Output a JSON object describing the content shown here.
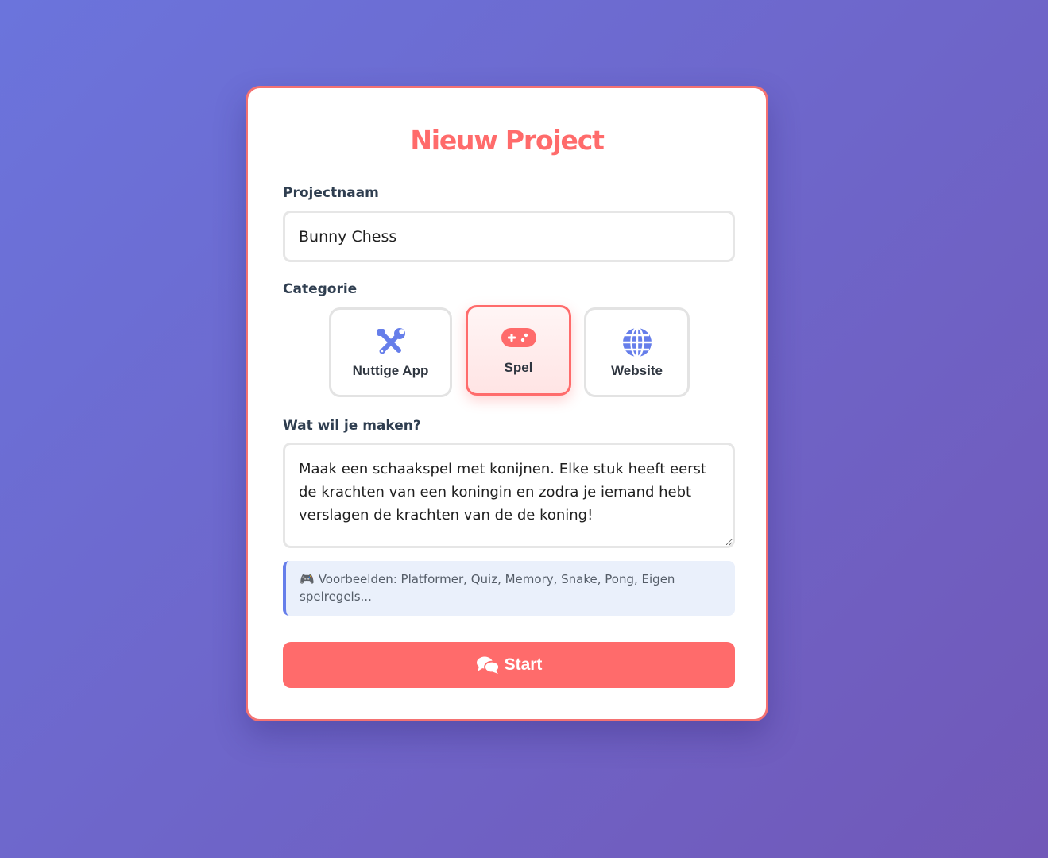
{
  "page": {
    "title": "Nieuw Project"
  },
  "colors": {
    "accent": "#ff6b6b",
    "icon": "#667eea",
    "background_start": "#6b74dc",
    "background_end": "#7158b8"
  },
  "form": {
    "project_name": {
      "label": "Projectnaam",
      "value": "Bunny Chess"
    },
    "category": {
      "label": "Categorie",
      "selected": "Spel",
      "options": [
        {
          "label": "Nuttige App",
          "icon": "tools-icon"
        },
        {
          "label": "Spel",
          "icon": "gamepad-icon"
        },
        {
          "label": "Website",
          "icon": "globe-icon"
        }
      ]
    },
    "description": {
      "label": "Wat wil je maken?",
      "value": "Maak een schaakspel met konijnen. Elke stuk heeft eerst de krachten van een koningin en zodra je iemand hebt verslagen de krachten van de de koning!"
    },
    "hint": {
      "icon": "🎮",
      "text": "Voorbeelden: Platformer, Quiz, Memory, Snake, Pong, Eigen spelregels..."
    },
    "submit": {
      "label": "Start",
      "icon": "chat-bubbles-icon"
    }
  }
}
